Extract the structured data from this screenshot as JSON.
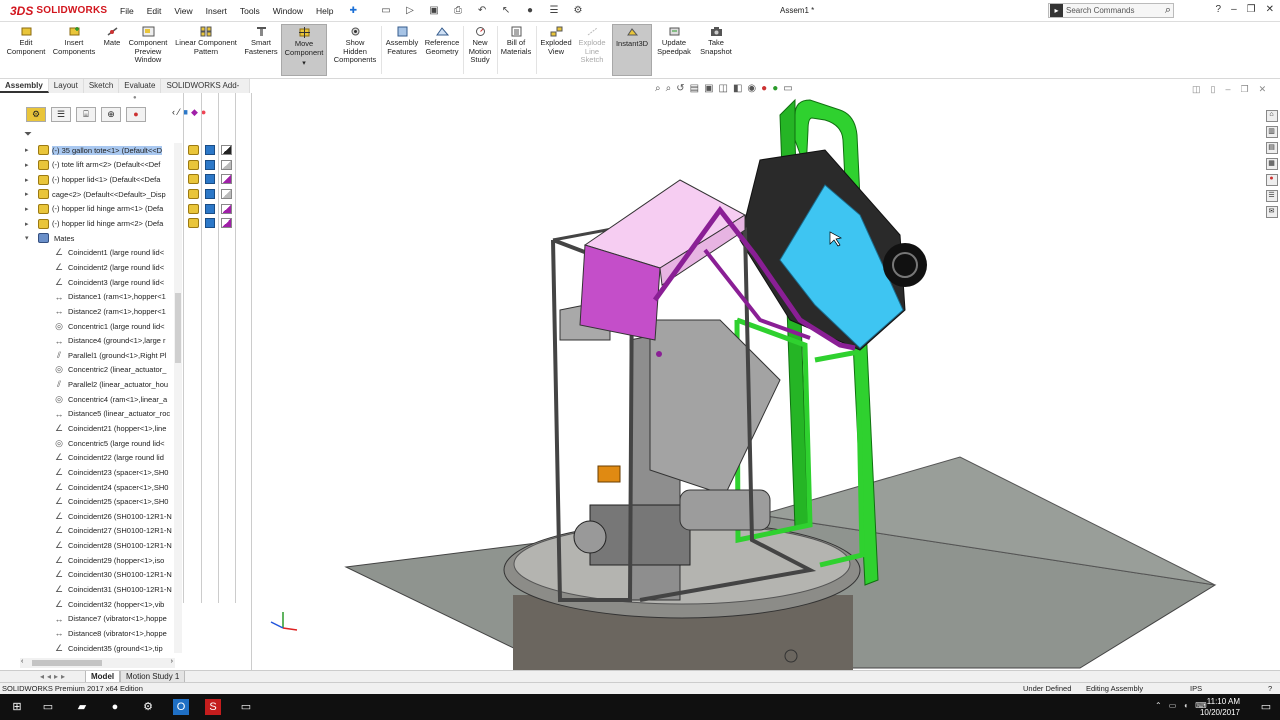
{
  "app": {
    "logo_mark": "3DS",
    "logo_text": "SOLIDWORKS",
    "document_title": "Assem1 *"
  },
  "menu": [
    "File",
    "Edit",
    "View",
    "Insert",
    "Tools",
    "Window",
    "Help"
  ],
  "search": {
    "placeholder": "Search Commands"
  },
  "ribbon": {
    "buttons": [
      {
        "label": "Edit\nComponent"
      },
      {
        "label": "Insert\nComponents"
      },
      {
        "label": "Mate"
      },
      {
        "label": "Component\nPreview\nWindow"
      },
      {
        "label": "Linear Component\nPattern"
      },
      {
        "label": "Smart\nFasteners"
      },
      {
        "label": "Move\nComponent"
      },
      {
        "label": "Show\nHidden\nComponents"
      },
      {
        "label": "Assembly\nFeatures"
      },
      {
        "label": "Reference\nGeometry"
      },
      {
        "label": "New\nMotion\nStudy"
      },
      {
        "label": "Bill of\nMaterials"
      },
      {
        "label": "Exploded\nView"
      },
      {
        "label": "Explode\nLine\nSketch"
      },
      {
        "label": "Instant3D"
      },
      {
        "label": "Update\nSpeedpak"
      },
      {
        "label": "Take\nSnapshot"
      }
    ]
  },
  "command_tabs": [
    "Assembly",
    "Layout",
    "Sketch",
    "Evaluate",
    "SOLIDWORKS Add-Ins"
  ],
  "tree": {
    "components": [
      "(-) 35 gallon tote<1> (Default<<D",
      "(-) tote lift arm<2> (Default<<Def",
      "(-) hopper lid<1> (Default<<Defa",
      "cage<2> (Default<<Default>_Disp",
      "(-) hopper lid hinge arm<1> (Defa",
      "(-) hopper lid hinge arm<2> (Defa"
    ],
    "mates_label": "Mates",
    "mates": [
      "Coincident1 (large round lid<",
      "Coincident2 (large round lid<",
      "Coincident3 (large round lid<",
      "Distance1 (ram<1>,hopper<1",
      "Distance2 (ram<1>,hopper<1",
      "Concentric1 (large round lid<",
      "Distance4 (ground<1>,large r",
      "Parallel1 (ground<1>,Right Pl",
      "Concentric2 (linear_actuator_",
      "Parallel2 (linear_actuator_hou",
      "Concentric4 (ram<1>,linear_a",
      "Distance5 (linear_actuator_roc",
      "Coincident21 (hopper<1>,line",
      "Concentric5 (large round lid<",
      "Coincident22 (large round lid",
      "Coincident23 (spacer<1>,SH0",
      "Coincident24 (spacer<1>,SH0",
      "Coincident25 (spacer<1>,SH0",
      "Coincident26 (SH0100-12R1-N",
      "Coincident27 (SH0100-12R1-N",
      "Coincident28 (SH0100-12R1-N",
      "Coincident29 (hopper<1>,iso",
      "Coincident30 (SH0100-12R1-N",
      "Coincident31 (SH0100-12R1-N",
      "Coincident32 (hopper<1>,vib",
      "Distance7 (vibrator<1>,hoppe",
      "Distance8 (vibrator<1>,hoppe",
      "Coincident35 (ground<1>,tip"
    ]
  },
  "bottom_tabs": [
    "Model",
    "Motion Study 1"
  ],
  "status": {
    "edition": "SOLIDWORKS Premium 2017 x64 Edition",
    "definition": "Under Defined",
    "mode": "Editing Assembly",
    "units": "IPS"
  },
  "taskbar": {
    "time": "11:10 AM",
    "date": "10/20/2017"
  },
  "colors": {
    "brand": "#d2161e",
    "selection": "#a9c8f0",
    "cage_green": "#2fd12f",
    "tote_blue": "#3ec5f2",
    "hopper_lid_pink": "#f6cdf2",
    "lift_arm_purple": "#8a1f95",
    "taskbar": "#101010"
  }
}
